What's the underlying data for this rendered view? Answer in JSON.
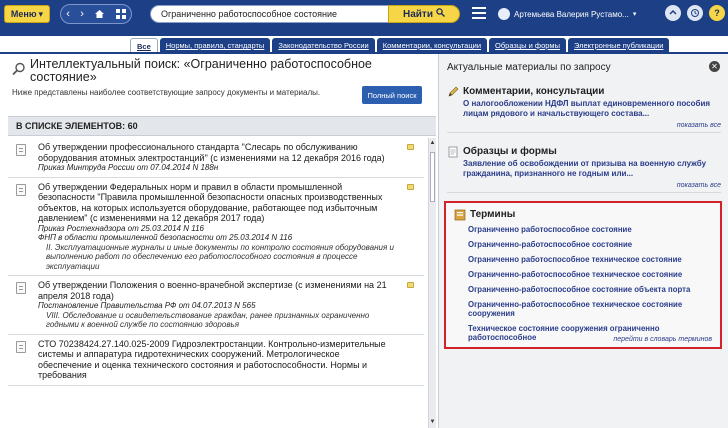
{
  "topbar": {
    "menu_label": "Меню",
    "search_value": "Ограниченно работоспособное состояние",
    "search_button": "Найти",
    "user_name": "Артемьева Валерия Рустамо..."
  },
  "tabs": [
    {
      "label": "Все",
      "active": true
    },
    {
      "label": "Нормы, правила, стандарты",
      "active": false
    },
    {
      "label": "Законодательство России",
      "active": false
    },
    {
      "label": "Комментарии, консультации",
      "active": false
    },
    {
      "label": "Образцы и формы",
      "active": false
    },
    {
      "label": "Электронные публикации",
      "active": false
    }
  ],
  "left": {
    "title": "Интеллектуальный поиск: «Ограниченно работоспособное состояние»",
    "description": "Ниже представлены наиболее соответствующие запросу документы и материалы.",
    "full_search_button": "Полный поиск",
    "count_label": "В СПИСКЕ ЭЛЕМЕНТОВ: 60",
    "items": [
      {
        "title": "Об утверждении профессионального стандарта \"Слесарь по обслуживанию оборудования атомных электростанций\" (с изменениями на 12 декабря 2016 года)",
        "meta": "Приказ Минтруда России от 07.04.2014 N 188н",
        "sub": ""
      },
      {
        "title": "Об утверждении Федеральных норм и правил в области промышленной безопасности \"Правила промышленной безопасности опасных производственных объектов, на которых используется оборудование, работающее под избыточным давлением\" (с изменениями на 12 декабря 2017 года)",
        "meta": "Приказ Ростехнадзора от 25.03.2014 N 116",
        "meta2": "ФНП в области промышленной безопасности от 25.03.2014 N 116",
        "sub": "II. Эксплуатационные журналы и иные документы по контролю состояния оборудования и выполнению работ по обеспечению его работоспособного состояния в процессе эксплуатации"
      },
      {
        "title": "Об утверждении Положения о военно-врачебной экспертизе (с изменениями на 21 апреля 2018 года)",
        "meta": "Постановление Правительства РФ от 04.07.2013 N 565",
        "sub": "VIII. Обследование и освидетельствование граждан, ранее признанных ограниченно годными к военной службе по состоянию здоровья"
      },
      {
        "title": "СТО 70238424.27.140.025-2009 Гидроэлектростанции. Контрольно-измерительные системы и аппаратура гидротехнических сооружений. Метрологическое обеспечение и оценка технического состояния и работоспособности. Нормы и требования",
        "meta": "",
        "sub": ""
      }
    ]
  },
  "right": {
    "header": "Актуальные материалы по запросу",
    "consult": {
      "title": "Комментарии, консультации",
      "link": "О налогообложении НДФЛ выплат единовременного пособия лицам рядового и начальствующего состава...",
      "more": "показать все"
    },
    "forms": {
      "title": "Образцы и формы",
      "link": "Заявление об освобождении от призыва на военную службу гражданина, признанного не годным или...",
      "more": "показать все"
    },
    "terms": {
      "title": "Термины",
      "items": [
        "Ограниченно работоспособное состояние",
        "Ограниченно-работоспособное состояние",
        "Ограниченно работоспособное техническое состояние",
        "Ограниченно-работоспособное техническое состояние",
        "Ограниченно-работоспособное состояние объекта порта",
        "Ограниченно-работоспособное техническое состояние сооружения",
        "Техническое состояние сооружения ограниченно работоспособное"
      ],
      "more": "перейти в словарь терминов"
    }
  },
  "colors": {
    "brand_blue": "#1c3f86",
    "accent_yellow": "#f6d646",
    "link_blue": "#2a3c8a",
    "highlight_red": "#d2232a"
  }
}
